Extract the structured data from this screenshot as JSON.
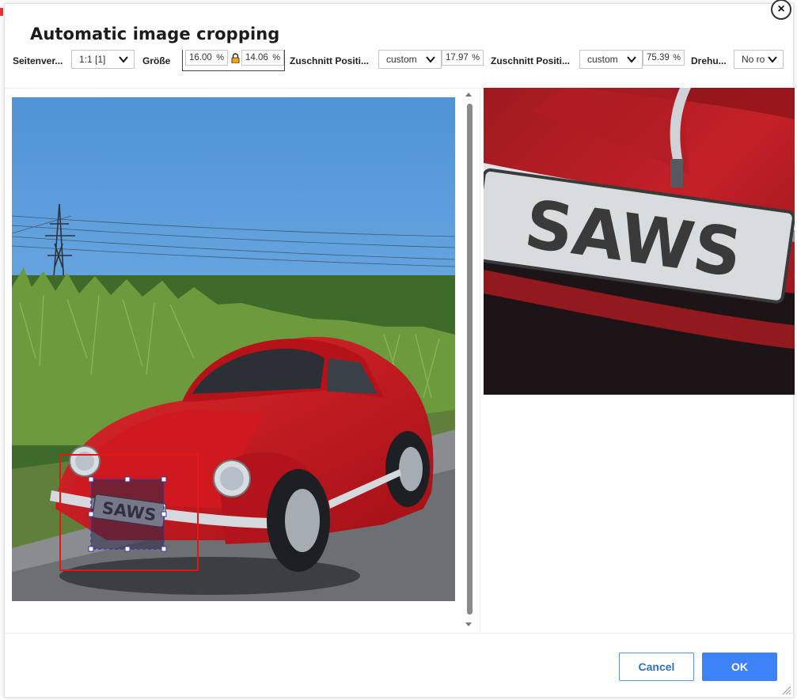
{
  "dialog": {
    "title": "Automatic image cropping",
    "close_symbol": "×"
  },
  "toolbar": {
    "aspect_label": "Seitenver...",
    "aspect_value": "1:1 [1]",
    "size_label": "Größe",
    "size_width": "16.00",
    "size_width_unit": "%",
    "size_height": "14.06",
    "size_height_unit": "%",
    "crop_pos_x_label": "Zuschnitt Positi...",
    "crop_pos_x_mode": "custom",
    "crop_pos_x_value": "17.97",
    "crop_pos_x_unit": "%",
    "crop_pos_y_label": "Zuschnitt Positi...",
    "crop_pos_y_mode": "custom",
    "crop_pos_y_value": "75.39",
    "crop_pos_y_unit": "%",
    "rotation_label": "Drehu...",
    "rotation_value": "No ro"
  },
  "preview": {
    "plate_text": "SAWS"
  },
  "footer": {
    "cancel_label": "Cancel",
    "ok_label": "OK"
  },
  "icons": [
    "close-icon",
    "chevron-down-icon",
    "lock-icon",
    "resize-grip-icon"
  ],
  "colors": {
    "accent": "#3e82f7",
    "crop_outer": "#e01818",
    "crop_inner": "#3a3aa8",
    "car_red": "#c8141c",
    "sky": "#5f9fd8"
  }
}
